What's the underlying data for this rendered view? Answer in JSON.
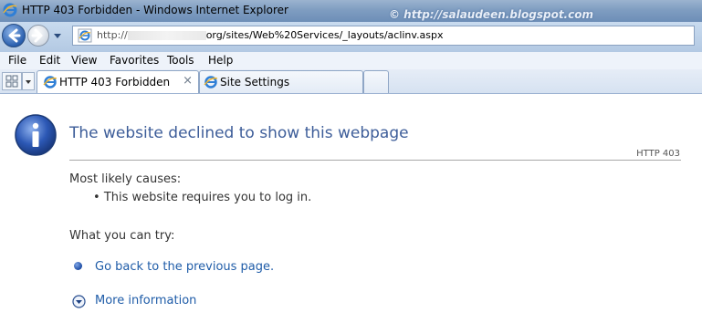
{
  "window": {
    "title": "HTTP 403 Forbidden - Windows Internet Explorer",
    "watermark": "© http://salaudeen.blogspot.com"
  },
  "address_bar": {
    "url_prefix": "http://",
    "url_redacted_tail": "",
    "url_visible": "org/sites/Web%20Services/_layouts/aclinv.aspx"
  },
  "menu": {
    "items": [
      "File",
      "Edit",
      "View",
      "Favorites",
      "Tools",
      "Help"
    ]
  },
  "tabs": [
    {
      "label": "HTTP 403 Forbidden",
      "active": true,
      "close": "×"
    },
    {
      "label": "Site Settings",
      "active": false
    }
  ],
  "page": {
    "heading": "The website declined to show this webpage",
    "http_code": "HTTP 403",
    "causes_title": "Most likely causes:",
    "causes": [
      "This website requires you to log in."
    ],
    "try_title": "What you can try:",
    "go_back_link": "Go back to the previous page.",
    "more_info_link": "More information"
  },
  "colors": {
    "heading": "#3d5d99",
    "link": "#1f5ca8",
    "title_bar": "#7f9dc1"
  },
  "icons": {
    "info": "info-icon",
    "ie": "ie-logo-icon",
    "more": "chevron-down-circle-icon"
  }
}
